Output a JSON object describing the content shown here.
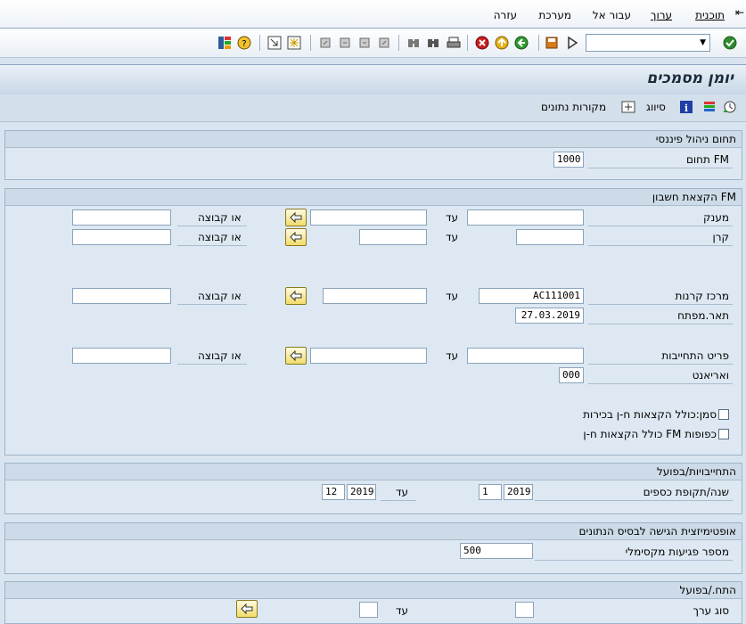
{
  "menu": {
    "items": [
      "תוכנית",
      "ערוך",
      "עבור אל",
      "מערכת",
      "עזרה"
    ]
  },
  "toolbar": {
    "command_field": ""
  },
  "title": "יומן מסמכים",
  "app_toolbar": {
    "sort_label": "סיווג",
    "data_sources_label": "מקורות נתונים"
  },
  "sections": {
    "fm_area": {
      "header": "תחום ניהול פיננסי",
      "fm_area_label": "תחום FM",
      "fm_area_value": "1000"
    },
    "fm_account": {
      "header": "הקצאת חשבון FM",
      "grant_label": "מענק",
      "fund_label": "קרן",
      "funds_center_label": "מרכז קרנות",
      "funds_center_value": "AC111001",
      "key_date_label": "תאר.מפתח",
      "key_date_value": "27.03.2019",
      "commitment_item_label": "פריט התחייבות",
      "variant_label": "ואריאנט",
      "variant_value": "000",
      "to_label": "עד",
      "or_group_label": "או קבוצה",
      "chk_selection_label": "סמן:כולל הקצאות ח-ן בכירות",
      "chk_duplicate_label": "כולל הקצאות ח-ן FM כפופות"
    },
    "commitments": {
      "header": "התחייבויות/בפועל",
      "fiscal_label": "שנה/תקופת כספים",
      "from_period": "1",
      "from_year": "2019",
      "to_label": "עד",
      "to_period": "12",
      "to_year": "2019"
    },
    "db_optimization": {
      "header": "אופטימיזצית הגישה לבסיס הנתונים",
      "max_hits_label": "מספר פגיעות מקסימלי",
      "max_hits_value": "500"
    },
    "actual": {
      "header": "התח./בפועל",
      "value_type_label": "סוג ערך",
      "to_label": "עד"
    }
  }
}
